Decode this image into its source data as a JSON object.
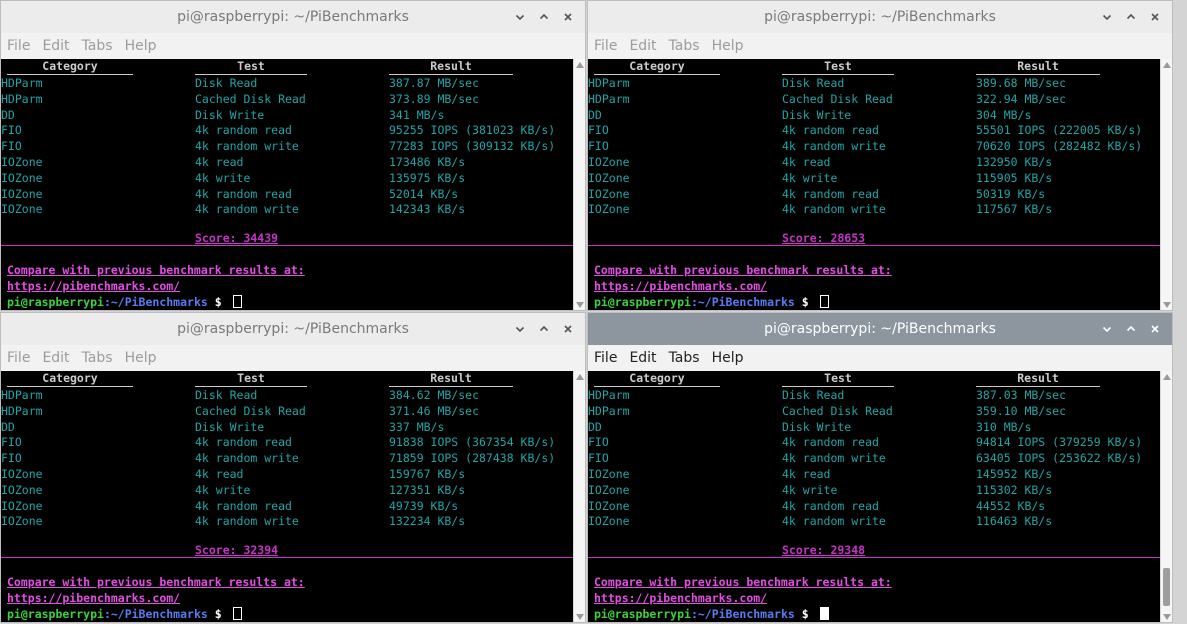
{
  "windows": [
    {
      "title": "pi@raspberrypi: ~/PiBenchmarks",
      "active": false,
      "menu": [
        "File",
        "Edit",
        "Tabs",
        "Help"
      ],
      "headers": [
        "Category",
        "Test",
        "Result"
      ],
      "rows": [
        [
          "HDParm",
          "Disk Read",
          "387.87 MB/sec"
        ],
        [
          "HDParm",
          "Cached Disk Read",
          "373.89 MB/sec"
        ],
        [
          "DD",
          "Disk Write",
          "341 MB/s"
        ],
        [
          "FIO",
          "4k random read",
          "95255 IOPS (381023 KB/s)"
        ],
        [
          "FIO",
          "4k random write",
          "77283 IOPS (309132 KB/s)"
        ],
        [
          "IOZone",
          "4k read",
          "173486 KB/s"
        ],
        [
          "IOZone",
          "4k write",
          "135975 KB/s"
        ],
        [
          "IOZone",
          "4k random read",
          "52014 KB/s"
        ],
        [
          "IOZone",
          "4k random write",
          "142343 KB/s"
        ]
      ],
      "score": "Score: 34439",
      "compare_text": "Compare with previous benchmark results at:",
      "url": "https://pibenchmarks.com/",
      "prompt_user": "pi@raspberrypi",
      "prompt_path": ":~/PiBenchmarks",
      "prompt_dollar": " $ "
    },
    {
      "title": "pi@raspberrypi: ~/PiBenchmarks",
      "active": false,
      "menu": [
        "File",
        "Edit",
        "Tabs",
        "Help"
      ],
      "headers": [
        "Category",
        "Test",
        "Result"
      ],
      "rows": [
        [
          "HDParm",
          "Disk Read",
          "389.68 MB/sec"
        ],
        [
          "HDParm",
          "Cached Disk Read",
          "322.94 MB/sec"
        ],
        [
          "DD",
          "Disk Write",
          "304 MB/s"
        ],
        [
          "FIO",
          "4k random read",
          "55501 IOPS (222005 KB/s)"
        ],
        [
          "FIO",
          "4k random write",
          "70620 IOPS (282482 KB/s)"
        ],
        [
          "IOZone",
          "4k read",
          "132950 KB/s"
        ],
        [
          "IOZone",
          "4k write",
          "115905 KB/s"
        ],
        [
          "IOZone",
          "4k random read",
          "50319 KB/s"
        ],
        [
          "IOZone",
          "4k random write",
          "117567 KB/s"
        ]
      ],
      "score": "Score: 28653",
      "compare_text": "Compare with previous benchmark results at:",
      "url": "https://pibenchmarks.com/",
      "prompt_user": "pi@raspberrypi",
      "prompt_path": ":~/PiBenchmarks",
      "prompt_dollar": " $ "
    },
    {
      "title": "pi@raspberrypi: ~/PiBenchmarks",
      "active": false,
      "menu": [
        "File",
        "Edit",
        "Tabs",
        "Help"
      ],
      "headers": [
        "Category",
        "Test",
        "Result"
      ],
      "rows": [
        [
          "HDParm",
          "Disk Read",
          "384.62 MB/sec"
        ],
        [
          "HDParm",
          "Cached Disk Read",
          "371.46 MB/sec"
        ],
        [
          "DD",
          "Disk Write",
          "337 MB/s"
        ],
        [
          "FIO",
          "4k random read",
          "91838 IOPS (367354 KB/s)"
        ],
        [
          "FIO",
          "4k random write",
          "71859 IOPS (287438 KB/s)"
        ],
        [
          "IOZone",
          "4k read",
          "159767 KB/s"
        ],
        [
          "IOZone",
          "4k write",
          "127351 KB/s"
        ],
        [
          "IOZone",
          "4k random read",
          "49739 KB/s"
        ],
        [
          "IOZone",
          "4k random write",
          "132234 KB/s"
        ]
      ],
      "score": "Score: 32394",
      "compare_text": "Compare with previous benchmark results at:",
      "url": "https://pibenchmarks.com/",
      "prompt_user": "pi@raspberrypi",
      "prompt_path": ":~/PiBenchmarks",
      "prompt_dollar": " $ "
    },
    {
      "title": "pi@raspberrypi: ~/PiBenchmarks",
      "active": true,
      "menu": [
        "File",
        "Edit",
        "Tabs",
        "Help"
      ],
      "headers": [
        "Category",
        "Test",
        "Result"
      ],
      "rows": [
        [
          "HDParm",
          "Disk Read",
          "387.03 MB/sec"
        ],
        [
          "HDParm",
          "Cached Disk Read",
          "359.10 MB/sec"
        ],
        [
          "DD",
          "Disk Write",
          "310 MB/s"
        ],
        [
          "FIO",
          "4k random read",
          "94814 IOPS (379259 KB/s)"
        ],
        [
          "FIO",
          "4k random write",
          "63405 IOPS (253622 KB/s)"
        ],
        [
          "IOZone",
          "4k read",
          "145952 KB/s"
        ],
        [
          "IOZone",
          "4k write",
          "115302 KB/s"
        ],
        [
          "IOZone",
          "4k random read",
          "44552 KB/s"
        ],
        [
          "IOZone",
          "4k random write",
          "116463 KB/s"
        ]
      ],
      "score": "Score: 29348",
      "compare_text": "Compare with previous benchmark results at:",
      "url": "https://pibenchmarks.com/",
      "prompt_user": "pi@raspberrypi",
      "prompt_path": ":~/PiBenchmarks",
      "prompt_dollar": " $ "
    }
  ],
  "icons": {
    "minimize": "chevron-down-icon",
    "maximize": "chevron-up-icon",
    "close": "close-icon"
  },
  "colors": {
    "terminal_bg": "#000000",
    "cyan_text": "#21a5a5",
    "magenta": "#c634c6",
    "prompt_green": "#3dd13d",
    "prompt_blue": "#5a7cf0",
    "active_titlebar": "#8d969e"
  }
}
